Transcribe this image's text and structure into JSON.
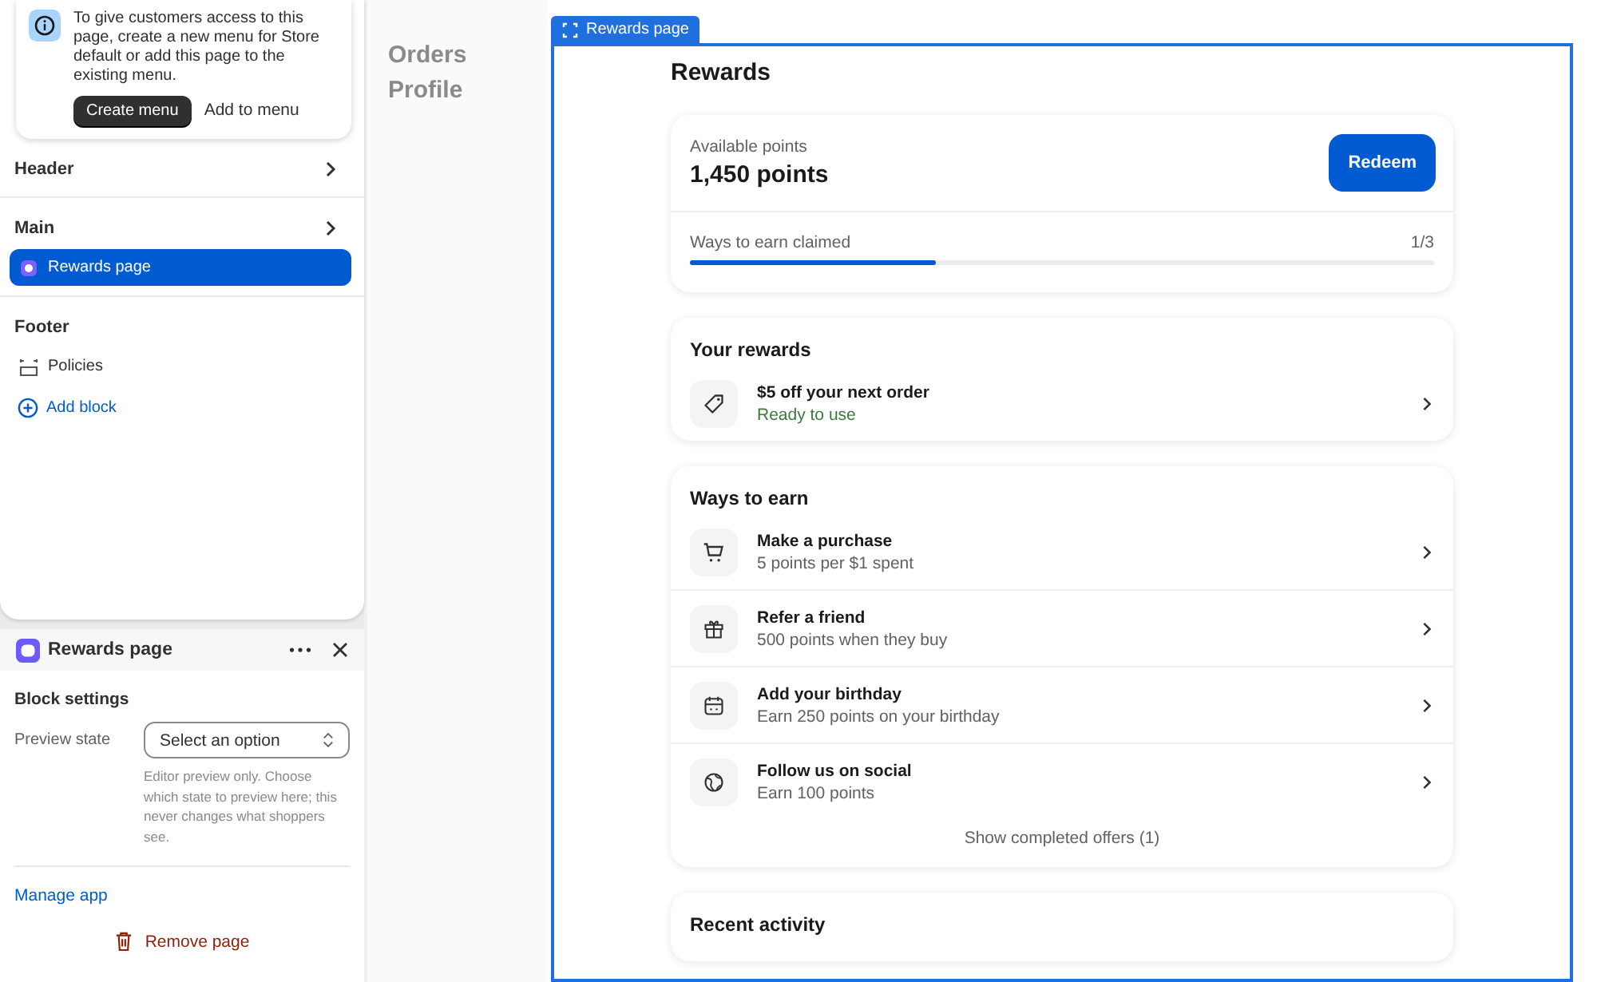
{
  "sidebar": {
    "notice": {
      "text": "To give customers access to this page, create a new menu for Store default or add this page to the existing menu.",
      "buttons": [
        {
          "label": "Create menu",
          "primary": true
        },
        {
          "label": "Add to menu",
          "primary": false
        }
      ]
    },
    "sections": [
      {
        "title": "Header",
        "chevron": true
      },
      {
        "title": "Main",
        "chevron": true,
        "items": [
          {
            "label": "Rewards page",
            "kind": "app",
            "selected": true
          }
        ]
      },
      {
        "title": "Footer",
        "chevron": false,
        "items": [
          {
            "label": "Policies",
            "kind": "section",
            "selected": false
          }
        ]
      }
    ],
    "add_block": "Add block"
  },
  "block_panel": {
    "title": "Rewards page",
    "settings_title": "Block settings",
    "field_label": "Preview state",
    "placeholder": "Select an option",
    "help": "Editor preview only. Choose which state to preview here; this never changes what shoppers see.",
    "manage_link": "Manage app",
    "remove": "Remove page"
  },
  "preview": {
    "nav": [
      "Orders",
      "Profile"
    ],
    "frame_tab": "Rewards page",
    "heading": "Rewards",
    "points": {
      "label": "Available points",
      "value": "1,450 points",
      "button": "Redeem",
      "progress_label": "Ways to earn claimed",
      "progress_count": "1/3",
      "level": 0.33
    },
    "your_rewards": {
      "title": "Your rewards",
      "items": [
        {
          "title": "$5 off your next order",
          "subtitle": "Ready to use",
          "ready": true
        }
      ]
    },
    "ways_to_earn": {
      "title": "Ways to earn",
      "items": [
        {
          "title": "Make a purchase",
          "subtitle": "5 points per $1 spent",
          "ready": false
        },
        {
          "title": "Refer a friend",
          "subtitle": "500 points when they buy",
          "ready": false
        },
        {
          "title": "Add your birthday",
          "subtitle": "Earn 250 points on your birthday",
          "ready": false
        },
        {
          "title": "Follow us on social",
          "subtitle": "Earn 100 points",
          "ready": false
        }
      ],
      "footer": "Show completed offers (1)"
    },
    "recent_activity": {
      "title": "Recent activity"
    }
  }
}
